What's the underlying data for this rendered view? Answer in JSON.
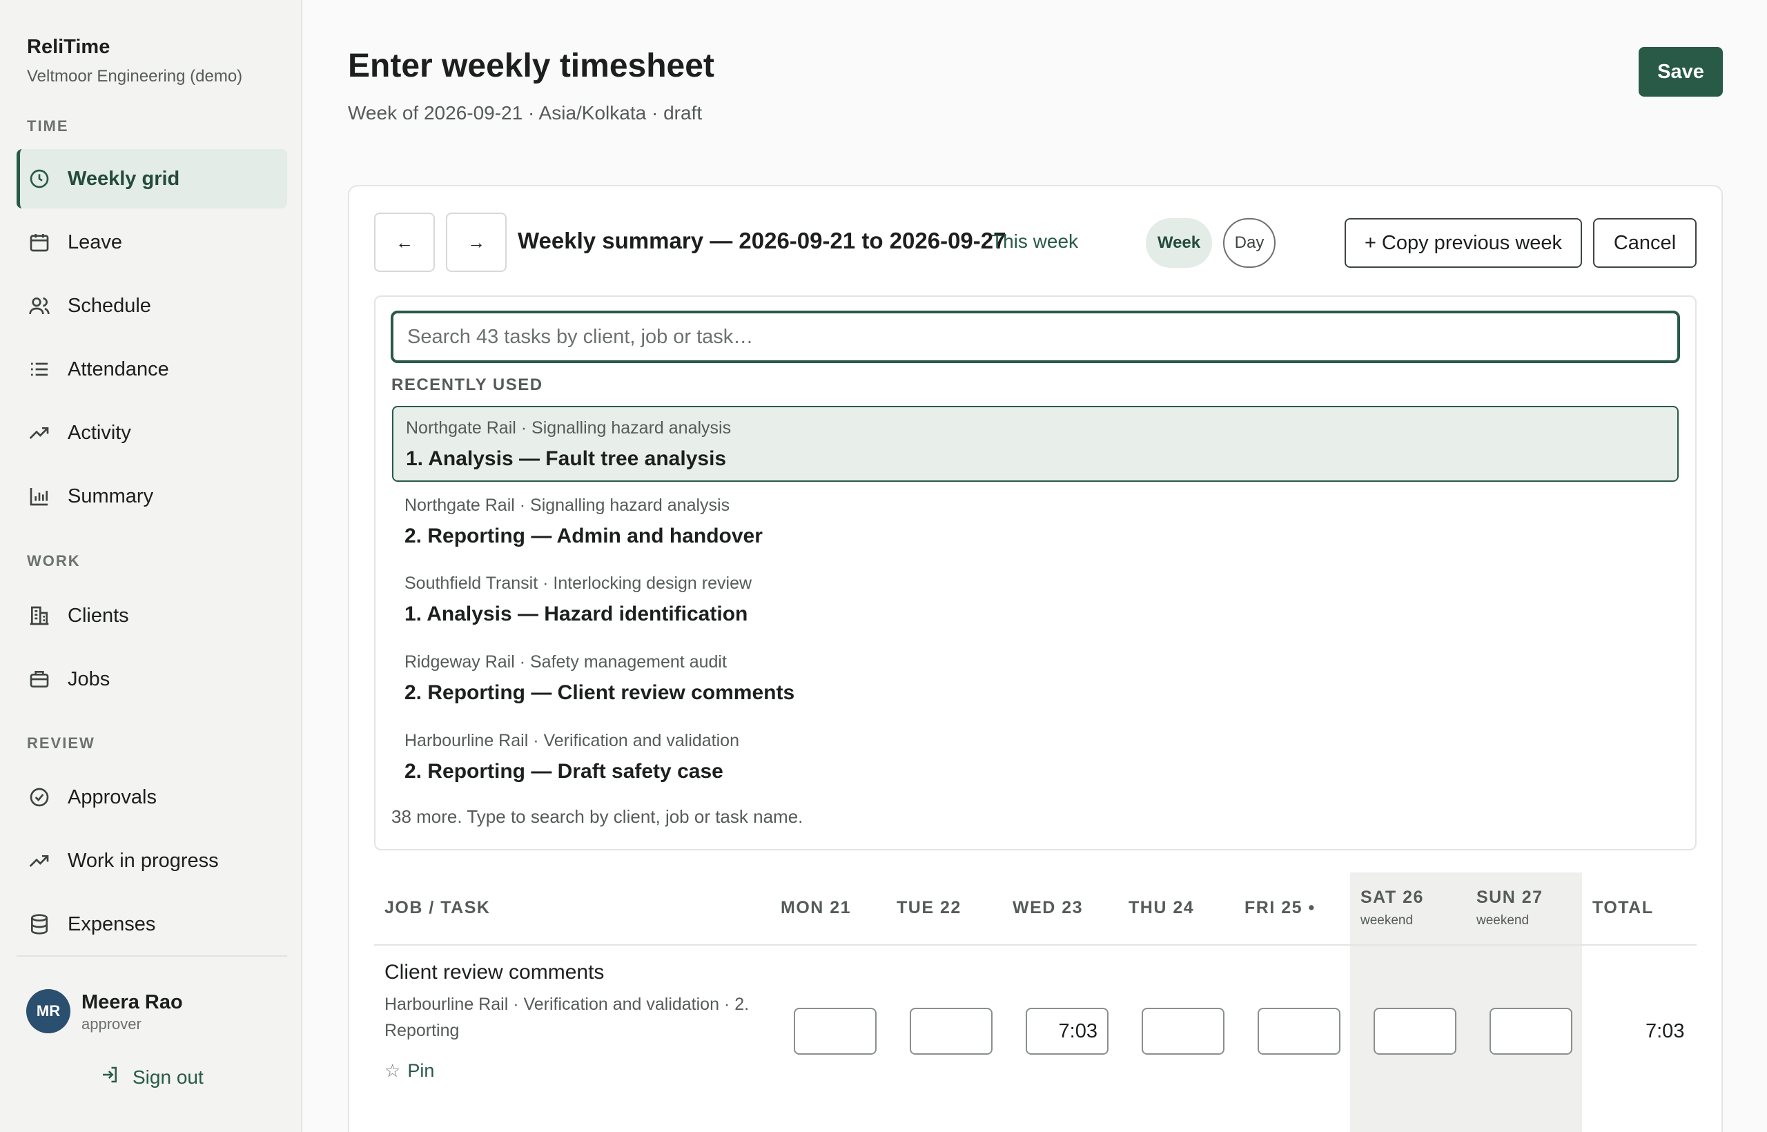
{
  "app": {
    "name": "ReliTime",
    "org": "Veltmoor Engineering (demo)"
  },
  "sidebar": {
    "sections": {
      "time": "TIME",
      "work": "WORK",
      "review": "REVIEW"
    },
    "items": [
      {
        "label": "Weekly grid",
        "icon": "clock-icon"
      },
      {
        "label": "Leave",
        "icon": "calendar-icon"
      },
      {
        "label": "Schedule",
        "icon": "users-icon"
      },
      {
        "label": "Attendance",
        "icon": "list-icon"
      },
      {
        "label": "Activity",
        "icon": "trend-icon"
      },
      {
        "label": "Summary",
        "icon": "bar-chart-icon"
      },
      {
        "label": "Clients",
        "icon": "building-icon"
      },
      {
        "label": "Jobs",
        "icon": "briefcase-icon"
      },
      {
        "label": "Approvals",
        "icon": "check-circle-icon"
      },
      {
        "label": "Work in progress",
        "icon": "trend-icon"
      },
      {
        "label": "Expenses",
        "icon": "database-icon"
      }
    ],
    "user": {
      "initials": "MR",
      "name": "Meera Rao",
      "role": "approver"
    },
    "sign_out": "Sign out"
  },
  "header": {
    "title": "Enter weekly timesheet",
    "subtitle": "Week of 2026-09-21 · Asia/Kolkata · draft",
    "save_label": "Save"
  },
  "toolbar": {
    "prev": "←",
    "next": "→",
    "week_title": "Weekly summary — 2026-09-21 to 2026-09-27",
    "this_week": "This week",
    "view_week": "Week",
    "view_day": "Day",
    "copy_label": "+ Copy previous week",
    "cancel_label": "Cancel"
  },
  "picker": {
    "search_placeholder": "Search 43 tasks by client, job or task…",
    "recent_label": "RECENTLY USED",
    "items": [
      {
        "meta": "Northgate Rail · Signalling hazard analysis",
        "name": "1. Analysis — Fault tree analysis"
      },
      {
        "meta": "Northgate Rail · Signalling hazard analysis",
        "name": "2. Reporting — Admin and handover"
      },
      {
        "meta": "Southfield Transit · Interlocking design review",
        "name": "1. Analysis — Hazard identification"
      },
      {
        "meta": "Ridgeway Rail · Safety management audit",
        "name": "2. Reporting — Client review comments"
      },
      {
        "meta": "Harbourline Rail · Verification and validation",
        "name": "2. Reporting — Draft safety case"
      }
    ],
    "more_note": "38 more. Type to search by client, job or task name."
  },
  "grid": {
    "headers": {
      "task": "JOB / TASK",
      "mon": "MON 21",
      "tue": "TUE 22",
      "wed": "WED 23",
      "thu": "THU 24",
      "fri": "FRI 25 •",
      "sat": "SAT 26",
      "sun": "SUN 27",
      "total": "TOTAL",
      "weekend": "weekend"
    },
    "rows": [
      {
        "title": "Client review comments",
        "meta": "Harbourline Rail · Verification and validation · 2. Reporting",
        "pin": "Pin",
        "values": {
          "mon": "",
          "tue": "",
          "wed": "7:03",
          "thu": "",
          "fri": "",
          "sat": "",
          "sun": ""
        },
        "total": "7:03"
      }
    ]
  },
  "colors": {
    "accent": "#285a47",
    "accent_bg": "#e3ece7",
    "avatar": "#2b4f6e"
  }
}
